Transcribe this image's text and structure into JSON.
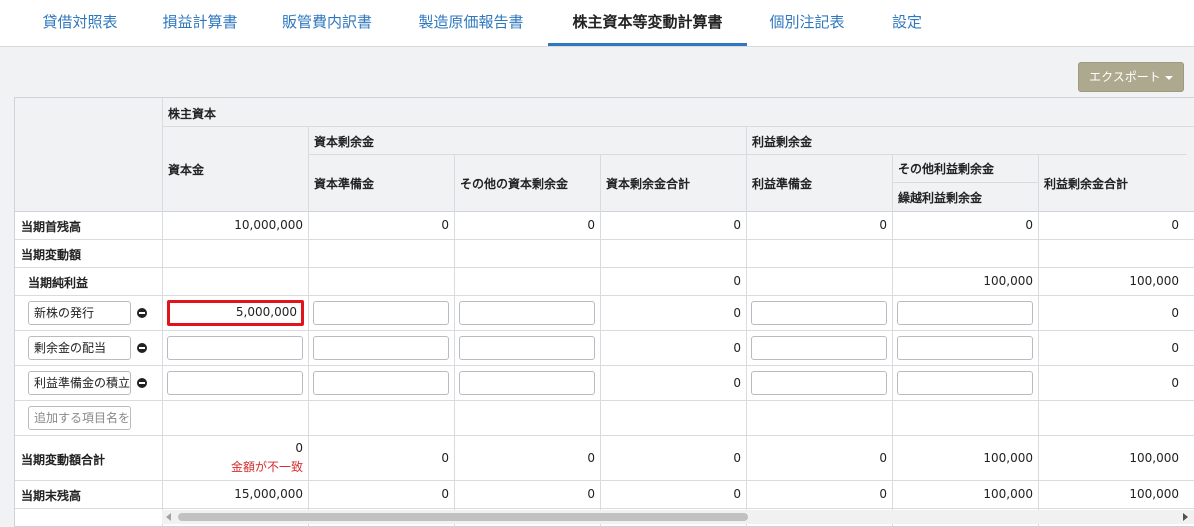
{
  "tabs": [
    {
      "label": "貸借対照表"
    },
    {
      "label": "損益計算書"
    },
    {
      "label": "販管費内訳書"
    },
    {
      "label": "製造原価報告書"
    },
    {
      "label": "株主資本等変動計算書",
      "active": true
    },
    {
      "label": "個別注記表"
    },
    {
      "label": "設定"
    }
  ],
  "toolbar": {
    "export_label": "エクスポート"
  },
  "headers": {
    "shareholders_equity": "株主資本",
    "capital": "資本金",
    "capital_surplus": "資本剰余金",
    "capital_reserve": "資本準備金",
    "other_capital_surplus": "その他の資本剰余金",
    "capital_surplus_total": "資本剰余金合計",
    "retained_earnings": "利益剰余金",
    "legal_reserve": "利益準備金",
    "other_retained_earnings": "その他利益剰余金",
    "retained_earnings_carried": "繰越利益剰余金",
    "retained_earnings_total": "利益剰余金合計"
  },
  "rows": {
    "opening": {
      "label": "当期首残高",
      "values": [
        "10,000,000",
        "0",
        "0",
        "0",
        "0",
        "0",
        "0"
      ]
    },
    "changes_label": "当期変動額",
    "net_income": {
      "label": "当期純利益",
      "capital_surplus_total": "0",
      "retained_earnings_carried": "100,000",
      "retained_earnings_total": "100,000"
    },
    "editable": [
      {
        "name": "新株の発行",
        "capital": "5,000,000",
        "capital_surplus_total": "0",
        "retained_earnings_total": "0"
      },
      {
        "name": "剰余金の配当",
        "capital": "",
        "capital_surplus_total": "0",
        "retained_earnings_total": "0"
      },
      {
        "name": "利益準備金の積立",
        "capital": "",
        "capital_surplus_total": "0",
        "retained_earnings_total": "0"
      }
    ],
    "add_item_placeholder": "追加する項目名を",
    "changes_total": {
      "label": "当期変動額合計",
      "capital": "0",
      "capital_warning": "金額が不一致",
      "values": [
        "0",
        "0",
        "0",
        "0",
        "100,000",
        "100,000"
      ]
    },
    "closing": {
      "label": "当期末残高",
      "values": [
        "15,000,000",
        "0",
        "0",
        "0",
        "0",
        "100,000",
        "100,000"
      ]
    }
  }
}
